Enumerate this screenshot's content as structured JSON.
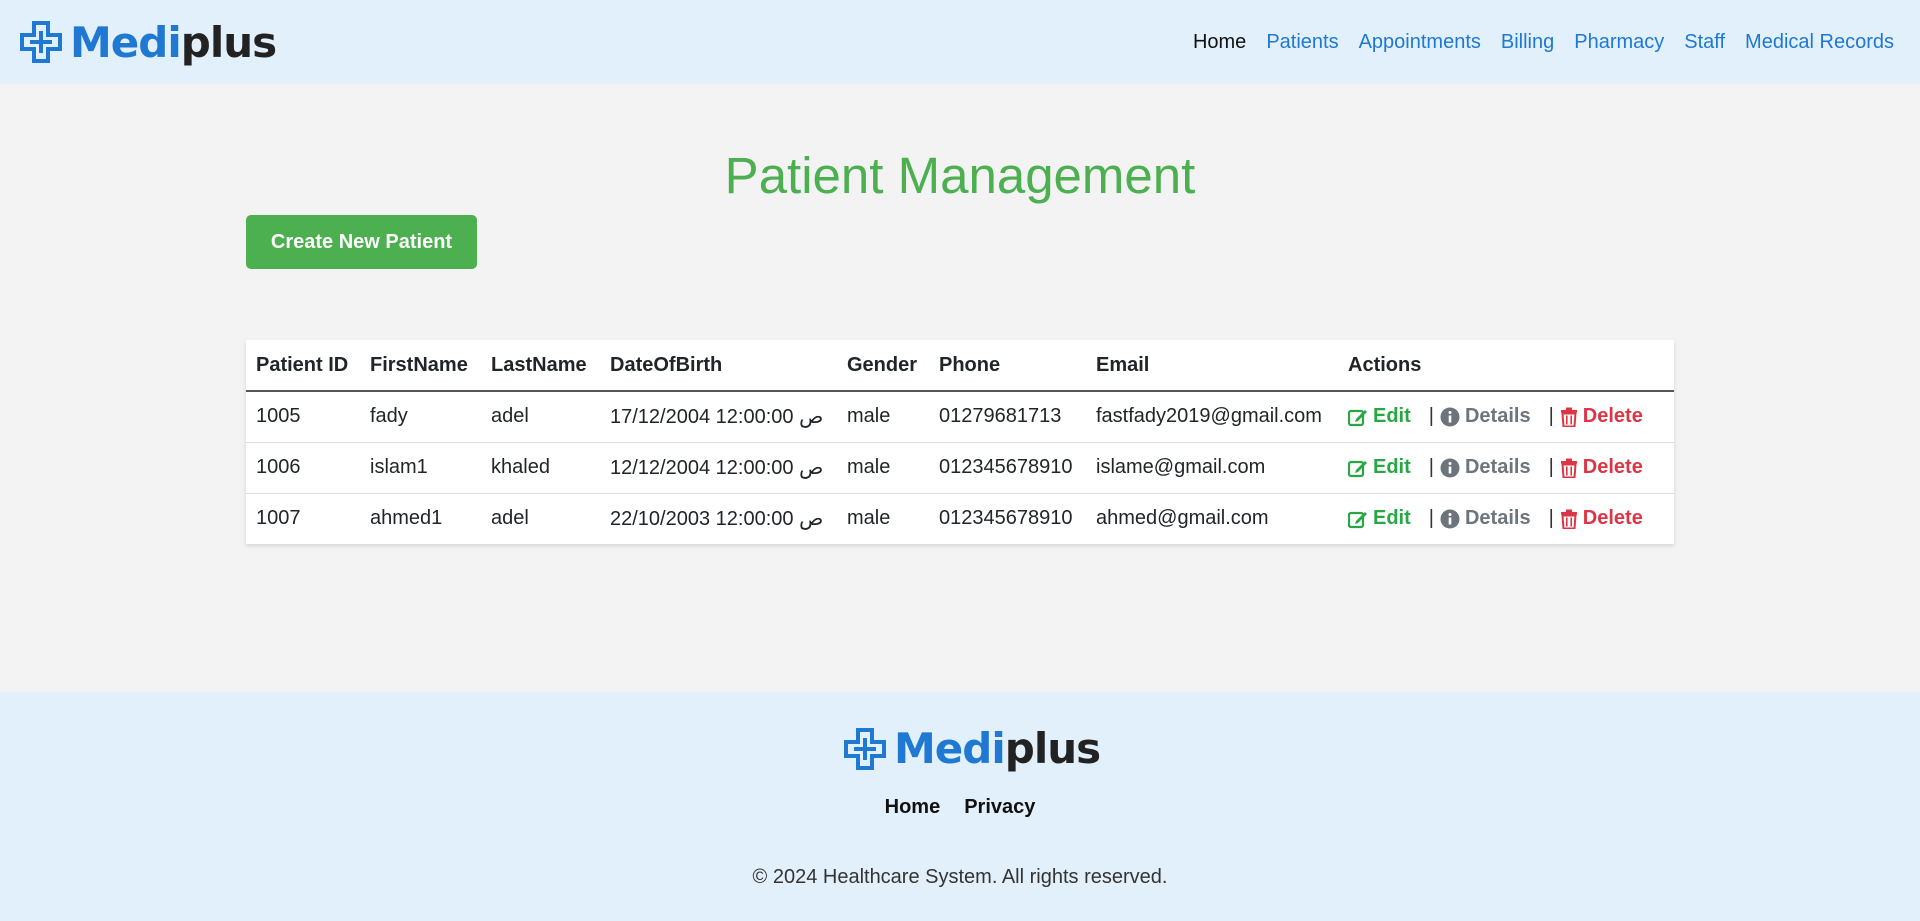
{
  "brand": {
    "name_part1": "Medi",
    "name_part2": "plus",
    "primary_color": "#1f78d1"
  },
  "nav": {
    "items": [
      {
        "label": "Home"
      },
      {
        "label": "Patients"
      },
      {
        "label": "Appointments"
      },
      {
        "label": "Billing"
      },
      {
        "label": "Pharmacy"
      },
      {
        "label": "Staff"
      },
      {
        "label": "Medical Records"
      }
    ]
  },
  "main": {
    "title": "Patient Management",
    "title_color": "#4caf50",
    "create_button": "Create New Patient"
  },
  "table": {
    "headers": [
      "Patient ID",
      "FirstName",
      "LastName",
      "DateOfBirth",
      "Gender",
      "Phone",
      "Email",
      "Actions"
    ],
    "rows": [
      {
        "id": "1005",
        "first": "fady",
        "last": "adel",
        "dob": "17/12/2004 12:00:00 ص",
        "gender": "male",
        "phone": "01279681713",
        "email": "fastfady2019@gmail.com"
      },
      {
        "id": "1006",
        "first": "islam1",
        "last": "khaled",
        "dob": "12/12/2004 12:00:00 ص",
        "gender": "male",
        "phone": "012345678910",
        "email": "islame@gmail.com"
      },
      {
        "id": "1007",
        "first": "ahmed1",
        "last": "adel",
        "dob": "22/10/2003 12:00:00 ص",
        "gender": "male",
        "phone": "012345678910",
        "email": "ahmed@gmail.com"
      }
    ],
    "actions": {
      "edit": "Edit",
      "details": "Details",
      "delete": "Delete",
      "separator": "|",
      "edit_icon": "edit-icon",
      "details_icon": "info-icon",
      "delete_icon": "trash-icon",
      "edit_color": "#28a745",
      "details_color": "#6c757d",
      "delete_color": "#dc3545"
    }
  },
  "footer": {
    "links": [
      {
        "label": "Home"
      },
      {
        "label": "Privacy"
      }
    ],
    "copyright": "© 2024 Healthcare System. All rights reserved."
  }
}
